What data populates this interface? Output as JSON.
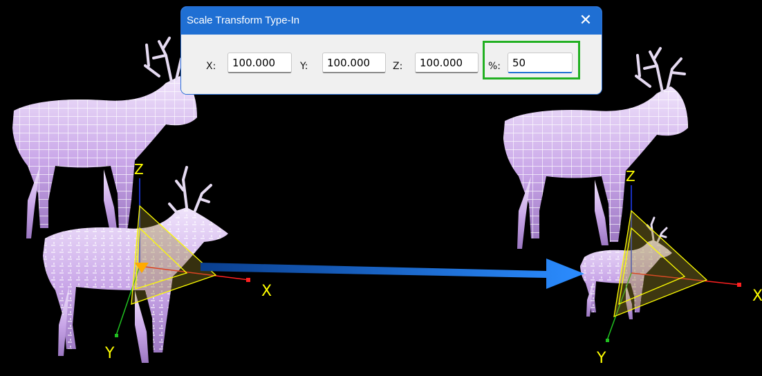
{
  "dialog": {
    "title": "Scale Transform Type-In",
    "close_icon": "close-icon",
    "fields": {
      "x": {
        "label": "X:",
        "value": "100.000"
      },
      "y": {
        "label": "Y:",
        "value": "100.000"
      },
      "z": {
        "label": "Z:",
        "value": "100.000"
      },
      "percent": {
        "label": "%:",
        "value": "50"
      }
    },
    "highlight_color": "#22b022"
  },
  "viewport": {
    "background": "#000000",
    "axis_labels": {
      "x": "X",
      "y": "Y",
      "z": "Z"
    },
    "axis_colors": {
      "x": "#ff2020",
      "y": "#20c020",
      "z": "#2040ff",
      "label": "#ffff00"
    },
    "model_color": "#c9a6e8",
    "arrow_color": "#1f7ae6"
  }
}
